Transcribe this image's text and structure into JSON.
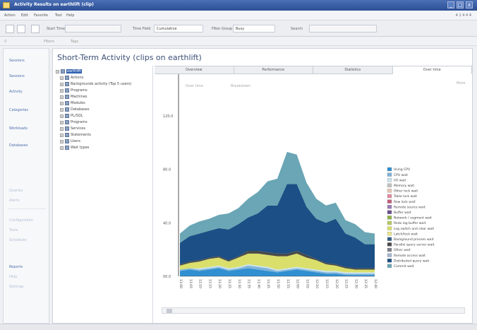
{
  "window": {
    "title": "Activity Results on earthlift (clip)",
    "controls": [
      "_",
      "□",
      "x"
    ]
  },
  "menu": {
    "items": [
      "Action",
      "Edit",
      "Favorite",
      "Tool",
      "Help"
    ],
    "right_text": "4 1 4 4 4"
  },
  "toolbar": {
    "start_time_label": "Start Time",
    "time_field_label": "Time Field",
    "time_field_value": "Cumulative",
    "filter_label": "Filter Group",
    "filter_value": "Busy",
    "search_label": "Search"
  },
  "toolbar2": {
    "items": [
      "Filters",
      "Tags"
    ]
  },
  "leftnav": {
    "items": [
      "Sessions",
      "Sessions",
      "Activity",
      "Categories",
      "Workloads",
      "Databases"
    ],
    "faint_items": [
      "Queries",
      "Alerts",
      "Configuration",
      "Tools",
      "Scheduler",
      "Reports",
      "Help",
      "Settings"
    ]
  },
  "main": {
    "title": "Short-Term Activity (clips on earthlift)"
  },
  "tree": {
    "items": [
      {
        "label": "earthlift",
        "selected": true
      },
      {
        "label": "Actions",
        "selected": false
      },
      {
        "label": "Backgrounds activity (Top 5 users)",
        "selected": false
      },
      {
        "label": "Programs",
        "selected": false
      },
      {
        "label": "Machines",
        "selected": false
      },
      {
        "label": "Modules",
        "selected": false
      },
      {
        "label": "Databases",
        "selected": false
      },
      {
        "label": "PL/SQL",
        "selected": false
      },
      {
        "label": "Programs",
        "selected": false
      },
      {
        "label": "Services",
        "selected": false
      },
      {
        "label": "Statements",
        "selected": false
      },
      {
        "label": "Users",
        "selected": false
      },
      {
        "label": "Wait types",
        "selected": false
      }
    ]
  },
  "tabs": [
    {
      "label": "Overview",
      "active": false
    },
    {
      "label": "Performance",
      "active": false
    },
    {
      "label": "Statistics",
      "active": false
    },
    {
      "label": "Over time",
      "active": true
    }
  ],
  "chart_controls": {
    "left": "Over time",
    "mid": "Breakdown",
    "right": "More"
  },
  "chart_data": {
    "type": "area",
    "stacked": true,
    "ylim": [
      0,
      130
    ],
    "yticks": [
      {
        "value": 0,
        "label": "00.0"
      },
      {
        "value": 40,
        "label": "40.0"
      },
      {
        "value": 80,
        "label": "80.0"
      },
      {
        "value": 120,
        "label": "120.0"
      }
    ],
    "x": [
      "11:00",
      "11:05",
      "11:10",
      "11:15",
      "11:20",
      "11:25",
      "11:30",
      "11:35",
      "11:40",
      "11:45",
      "11:50",
      "11:55",
      "12:00",
      "12:05",
      "12:10",
      "12:15",
      "12:20",
      "12:25",
      "12:30",
      "12:35",
      "12:40"
    ],
    "series": [
      {
        "name": "Using CPU",
        "color": "#2f8fd0",
        "values": [
          4,
          5,
          4,
          5,
          6,
          4,
          5,
          6,
          5,
          4,
          3,
          4,
          5,
          4,
          3,
          2,
          2,
          1,
          1,
          1,
          1
        ]
      },
      {
        "name": "CPU wait",
        "color": "#7fb2d9",
        "values": [
          1,
          1,
          1,
          1,
          1,
          1,
          1,
          2,
          2,
          2,
          1,
          1,
          1,
          1,
          1,
          1,
          1,
          1,
          1,
          1,
          1
        ]
      },
      {
        "name": "I/O wait",
        "color": "#c9e4ef",
        "values": [
          0,
          0,
          1,
          1,
          1,
          1,
          1,
          1,
          1,
          1,
          1,
          1,
          1,
          1,
          1,
          1,
          1,
          1,
          1,
          1,
          1
        ]
      },
      {
        "name": "Memory wait",
        "color": "#c2c2c2",
        "values": [
          0,
          0,
          0,
          0,
          0,
          0,
          0,
          0,
          0,
          0,
          0,
          0,
          0,
          0,
          0,
          0,
          0,
          0,
          0,
          0,
          0
        ]
      },
      {
        "name": "Other lock wait",
        "color": "#e4c5b4",
        "values": [
          0,
          0,
          0,
          0,
          0,
          0,
          0,
          0,
          0,
          0,
          0,
          0,
          0,
          0,
          0,
          0,
          0,
          0,
          0,
          0,
          0
        ]
      },
      {
        "name": "Table lock wait",
        "color": "#e38aa0",
        "values": [
          0,
          0,
          0,
          0,
          0,
          0,
          0,
          0,
          0,
          0,
          0,
          0,
          0,
          0,
          0,
          0,
          0,
          0,
          0,
          0,
          0
        ]
      },
      {
        "name": "Row lock wait",
        "color": "#c0607a",
        "values": [
          0,
          0,
          0,
          0,
          0,
          0,
          0,
          0,
          0,
          0,
          0,
          0,
          0,
          0,
          0,
          0,
          0,
          0,
          0,
          0,
          0
        ]
      },
      {
        "name": "Remote source wait",
        "color": "#9a7ab5",
        "values": [
          0,
          0,
          0,
          0,
          0,
          0,
          0,
          0,
          0,
          0,
          0,
          0,
          0,
          0,
          0,
          0,
          0,
          0,
          0,
          0,
          0
        ]
      },
      {
        "name": "Buffer wait",
        "color": "#6a4f8e",
        "values": [
          0,
          0,
          0,
          0,
          0,
          0,
          0,
          0,
          0,
          0,
          0,
          0,
          0,
          0,
          0,
          0,
          0,
          0,
          0,
          0,
          0
        ]
      },
      {
        "name": "Network / segment wait",
        "color": "#8fb24a",
        "values": [
          0,
          0,
          0,
          0,
          0,
          0,
          0,
          0,
          0,
          0,
          0,
          0,
          0,
          0,
          0,
          0,
          0,
          0,
          0,
          0,
          0
        ]
      },
      {
        "name": "Redo log buffer wait",
        "color": "#b7c865",
        "values": [
          0,
          0,
          0,
          0,
          0,
          0,
          0,
          0,
          0,
          0,
          0,
          0,
          0,
          0,
          0,
          0,
          0,
          0,
          0,
          0,
          0
        ]
      },
      {
        "name": "Log switch and clear wait",
        "color": "#d9df6a",
        "values": [
          3,
          4,
          5,
          6,
          6,
          5,
          7,
          8,
          9,
          9,
          10,
          9,
          10,
          8,
          7,
          5,
          4,
          3,
          2,
          2,
          2
        ]
      },
      {
        "name": "Latch/lock wait",
        "color": "#e8e68c",
        "values": [
          0,
          0,
          0,
          0,
          0,
          0,
          0,
          0,
          0,
          0,
          0,
          0,
          0,
          0,
          0,
          0,
          0,
          0,
          0,
          0,
          0
        ]
      },
      {
        "name": "Background process wait",
        "color": "#355f8a",
        "values": [
          0,
          0,
          0,
          0,
          0,
          0,
          0,
          0,
          0,
          0,
          0,
          0,
          0,
          0,
          0,
          0,
          0,
          0,
          0,
          0,
          0
        ]
      },
      {
        "name": "Parallel query server wait",
        "color": "#4a4a4a",
        "values": [
          1,
          1,
          1,
          1,
          1,
          1,
          1,
          2,
          2,
          2,
          2,
          2,
          2,
          2,
          1,
          1,
          1,
          1,
          1,
          1,
          1
        ]
      },
      {
        "name": "Other wait",
        "color": "#7a7f8a",
        "values": [
          0,
          0,
          0,
          0,
          0,
          0,
          0,
          0,
          0,
          0,
          0,
          0,
          0,
          0,
          0,
          0,
          0,
          0,
          0,
          0,
          0
        ]
      },
      {
        "name": "Remote access wait",
        "color": "#a4b5d0",
        "values": [
          0,
          0,
          0,
          0,
          0,
          0,
          0,
          0,
          0,
          0,
          0,
          0,
          0,
          0,
          0,
          0,
          0,
          0,
          0,
          0,
          0
        ]
      },
      {
        "name": "Distributed query wait",
        "color": "#1b4f85",
        "values": [
          16,
          19,
          20,
          20,
          21,
          23,
          24,
          25,
          28,
          35,
          36,
          52,
          50,
          36,
          30,
          30,
          34,
          25,
          23,
          18,
          18
        ]
      },
      {
        "name": "Commit wait",
        "color": "#6aa6b5",
        "values": [
          7,
          8,
          9,
          9,
          10,
          12,
          12,
          14,
          16,
          18,
          20,
          24,
          22,
          18,
          15,
          13,
          12,
          10,
          10,
          9,
          8
        ]
      }
    ],
    "legend_position": "right"
  }
}
